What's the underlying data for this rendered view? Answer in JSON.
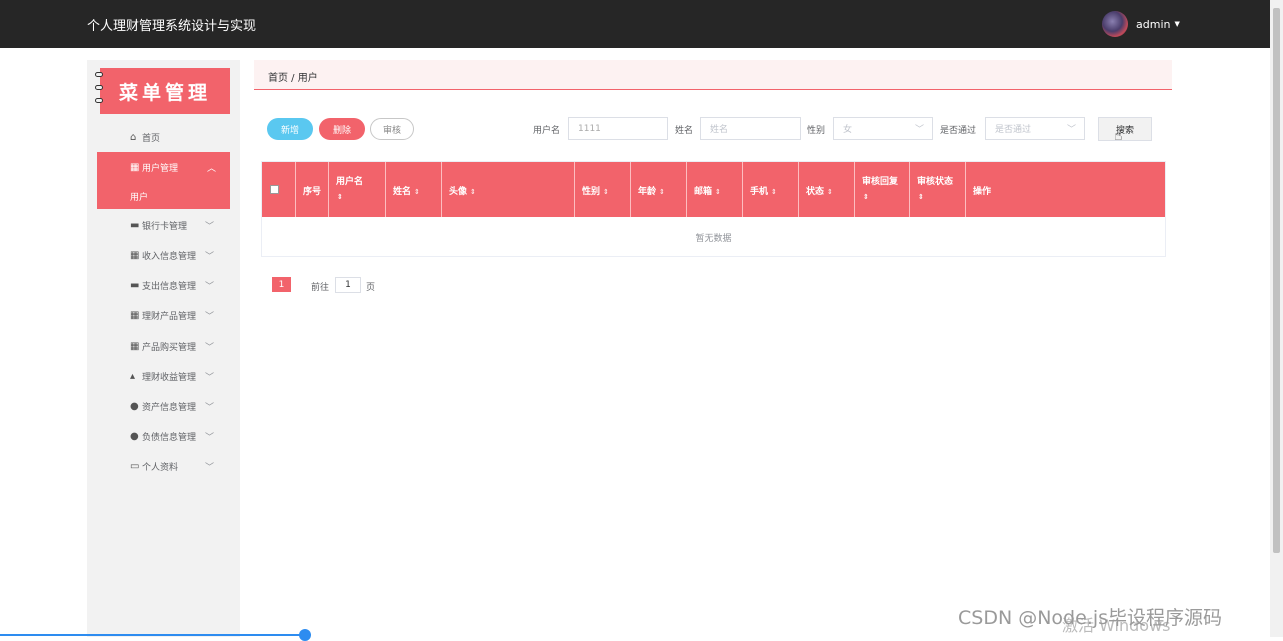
{
  "app": {
    "title": "个人理财管理系统设计与实现",
    "username": "admin"
  },
  "sidebar": {
    "header": "菜单管理",
    "items": [
      {
        "label": "首页",
        "icon": "home-icon"
      },
      {
        "label": "用户管理",
        "icon": "grid-icon",
        "expanded": true
      },
      {
        "label": "银行卡管理",
        "icon": "card-icon"
      },
      {
        "label": "收入信息管理",
        "icon": "grid-icon"
      },
      {
        "label": "支出信息管理",
        "icon": "card-icon"
      },
      {
        "label": "理财产品管理",
        "icon": "grid-icon"
      },
      {
        "label": "产品购买管理",
        "icon": "grid-icon"
      },
      {
        "label": "理财收益管理",
        "icon": "thumb-icon"
      },
      {
        "label": "资产信息管理",
        "icon": "user-icon"
      },
      {
        "label": "负债信息管理",
        "icon": "user-upload-icon"
      },
      {
        "label": "个人资料",
        "icon": "profile-icon"
      }
    ],
    "sub_item": "用户"
  },
  "breadcrumb": "首页 / 用户",
  "toolbar": {
    "add": "新增",
    "delete": "删除",
    "audit": "审核",
    "search": "搜索"
  },
  "filters": {
    "username_label": "用户名",
    "username_value": "1111",
    "name_label": "姓名",
    "name_placeholder": "姓名",
    "gender_label": "性别",
    "gender_value": "女",
    "approved_label": "是否通过",
    "approved_placeholder": "是否通过"
  },
  "table": {
    "columns": [
      "序号",
      "用户名",
      "姓名",
      "头像",
      "性别",
      "年龄",
      "邮箱",
      "手机",
      "状态",
      "审核回复",
      "审核状态",
      "操作"
    ],
    "empty_text": "暂无数据"
  },
  "pagination": {
    "current_page": "1",
    "goto_label": "前往",
    "goto_value": "1",
    "page_suffix": "页"
  },
  "watermark": {
    "csdn": "CSDN @Node.js毕设程序源码",
    "windows": "激活 Windows"
  },
  "colors": {
    "primary": "#f2636b",
    "topbar": "#262626",
    "add_button": "#5ac8f0"
  }
}
